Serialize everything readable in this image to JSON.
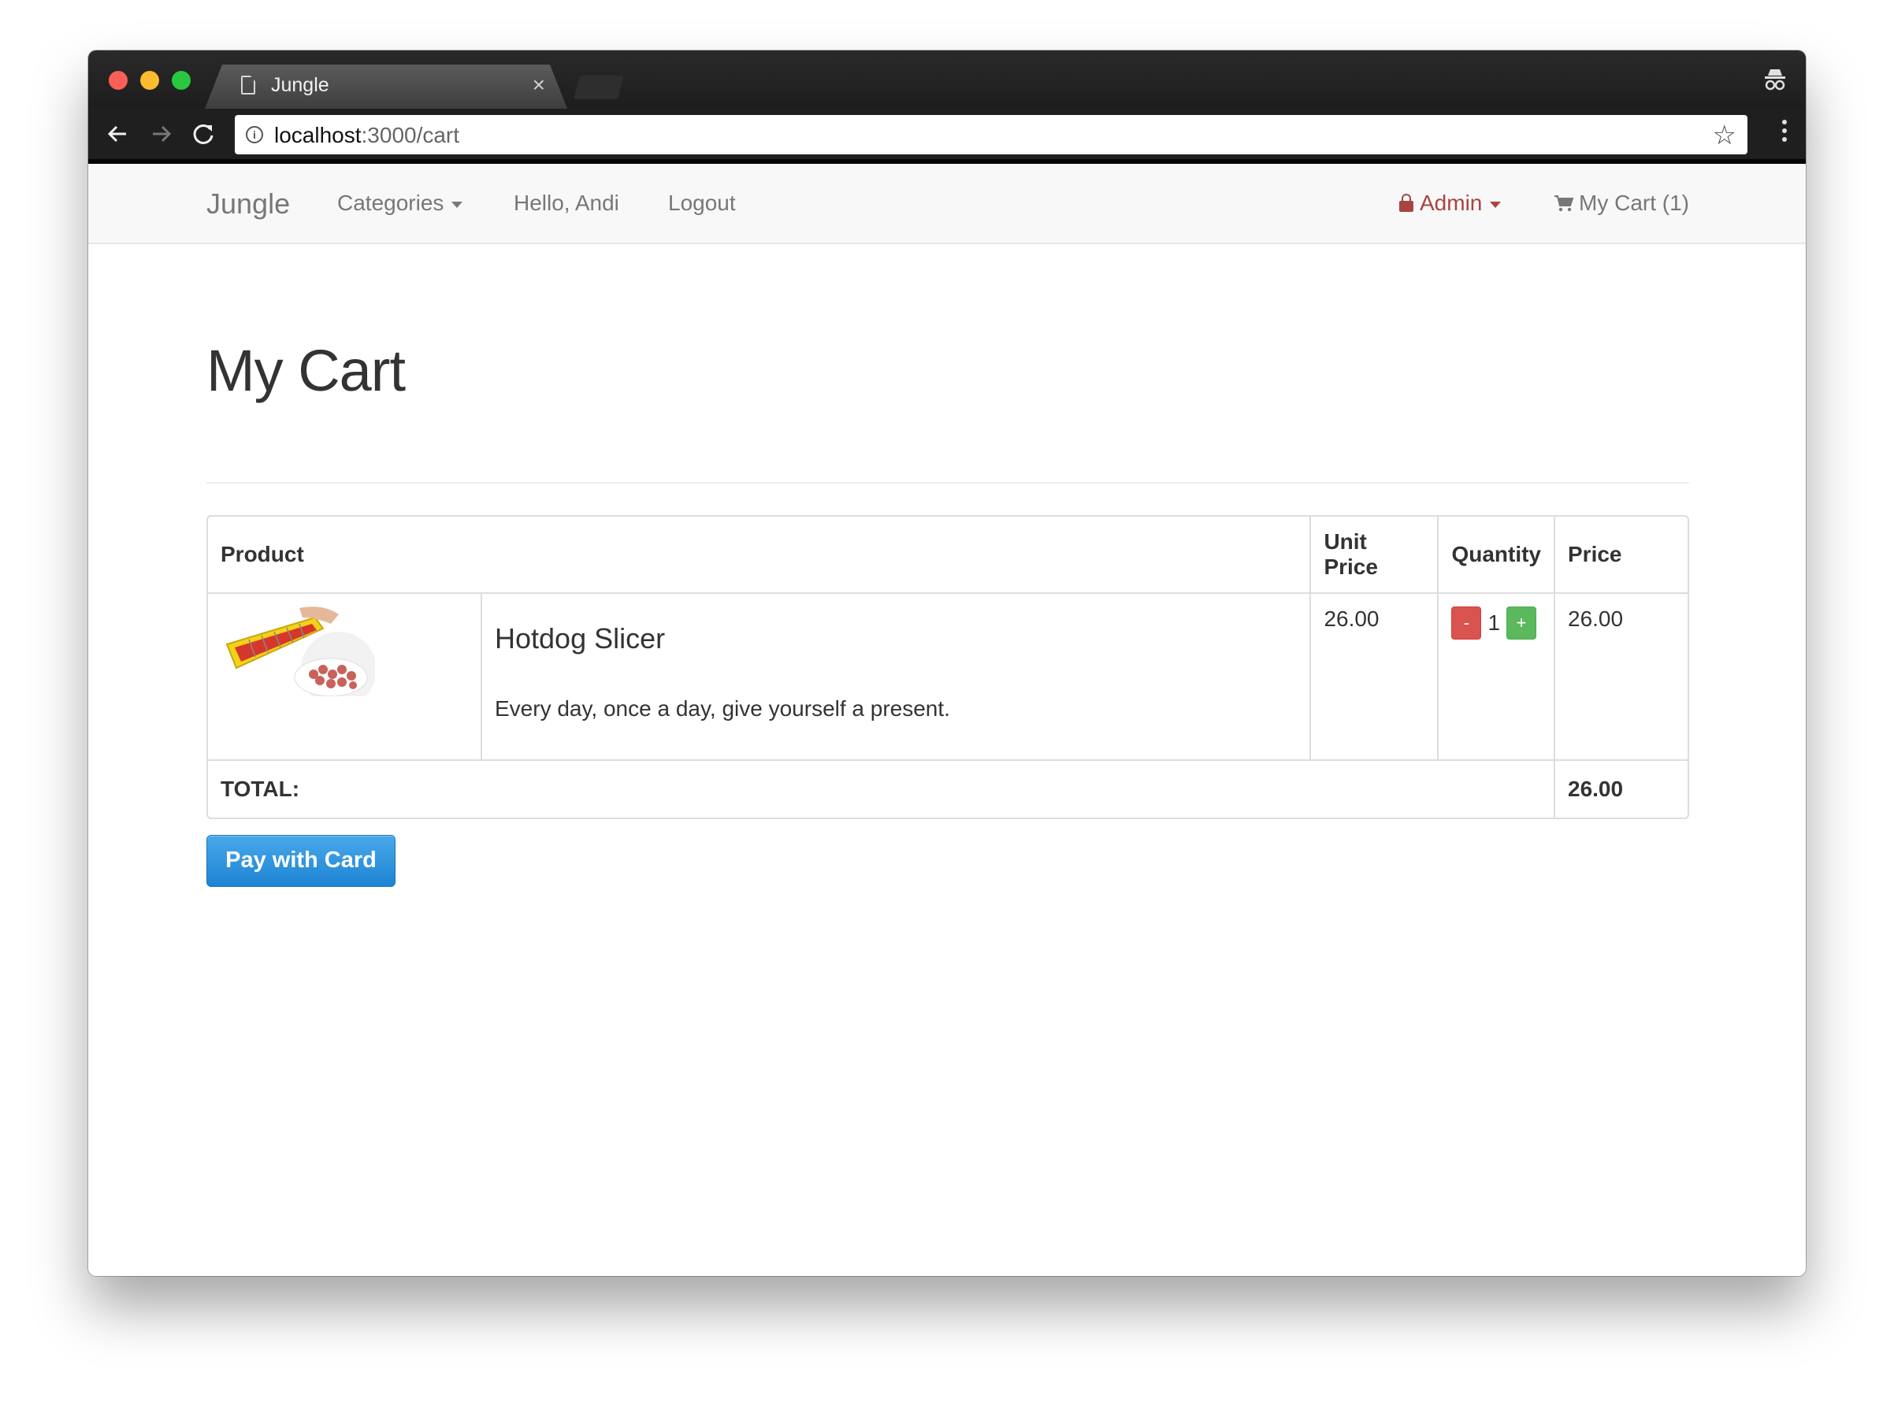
{
  "browser": {
    "tab_title": "Jungle",
    "tab_close": "×",
    "url_host": "localhost",
    "url_path": ":3000/cart",
    "icons": [
      "document-icon",
      "incognito-icon",
      "back-arrow-icon",
      "forward-arrow-icon",
      "reload-icon",
      "info-icon",
      "star-icon",
      "menu-icon"
    ]
  },
  "navbar": {
    "brand": "Jungle",
    "categories": "Categories",
    "hello": "Hello, Andi",
    "logout": "Logout",
    "admin": "Admin",
    "cart": "My Cart (1)",
    "admin_color": "#a94442"
  },
  "page": {
    "title": "My Cart"
  },
  "cart": {
    "headers": {
      "product": "Product",
      "unit_price": "Unit Price",
      "quantity": "Quantity",
      "price": "Price"
    },
    "items": [
      {
        "name": "Hotdog Slicer",
        "description": "Every day, once a day, give yourself a present.",
        "unit_price": "26.00",
        "quantity": "1",
        "minus_label": "-",
        "plus_label": "+",
        "price": "26.00"
      }
    ],
    "total_label": "TOTAL:",
    "total_value": "26.00"
  },
  "actions": {
    "pay_button": "Pay with Card",
    "pay_color": "#1d84d4"
  }
}
